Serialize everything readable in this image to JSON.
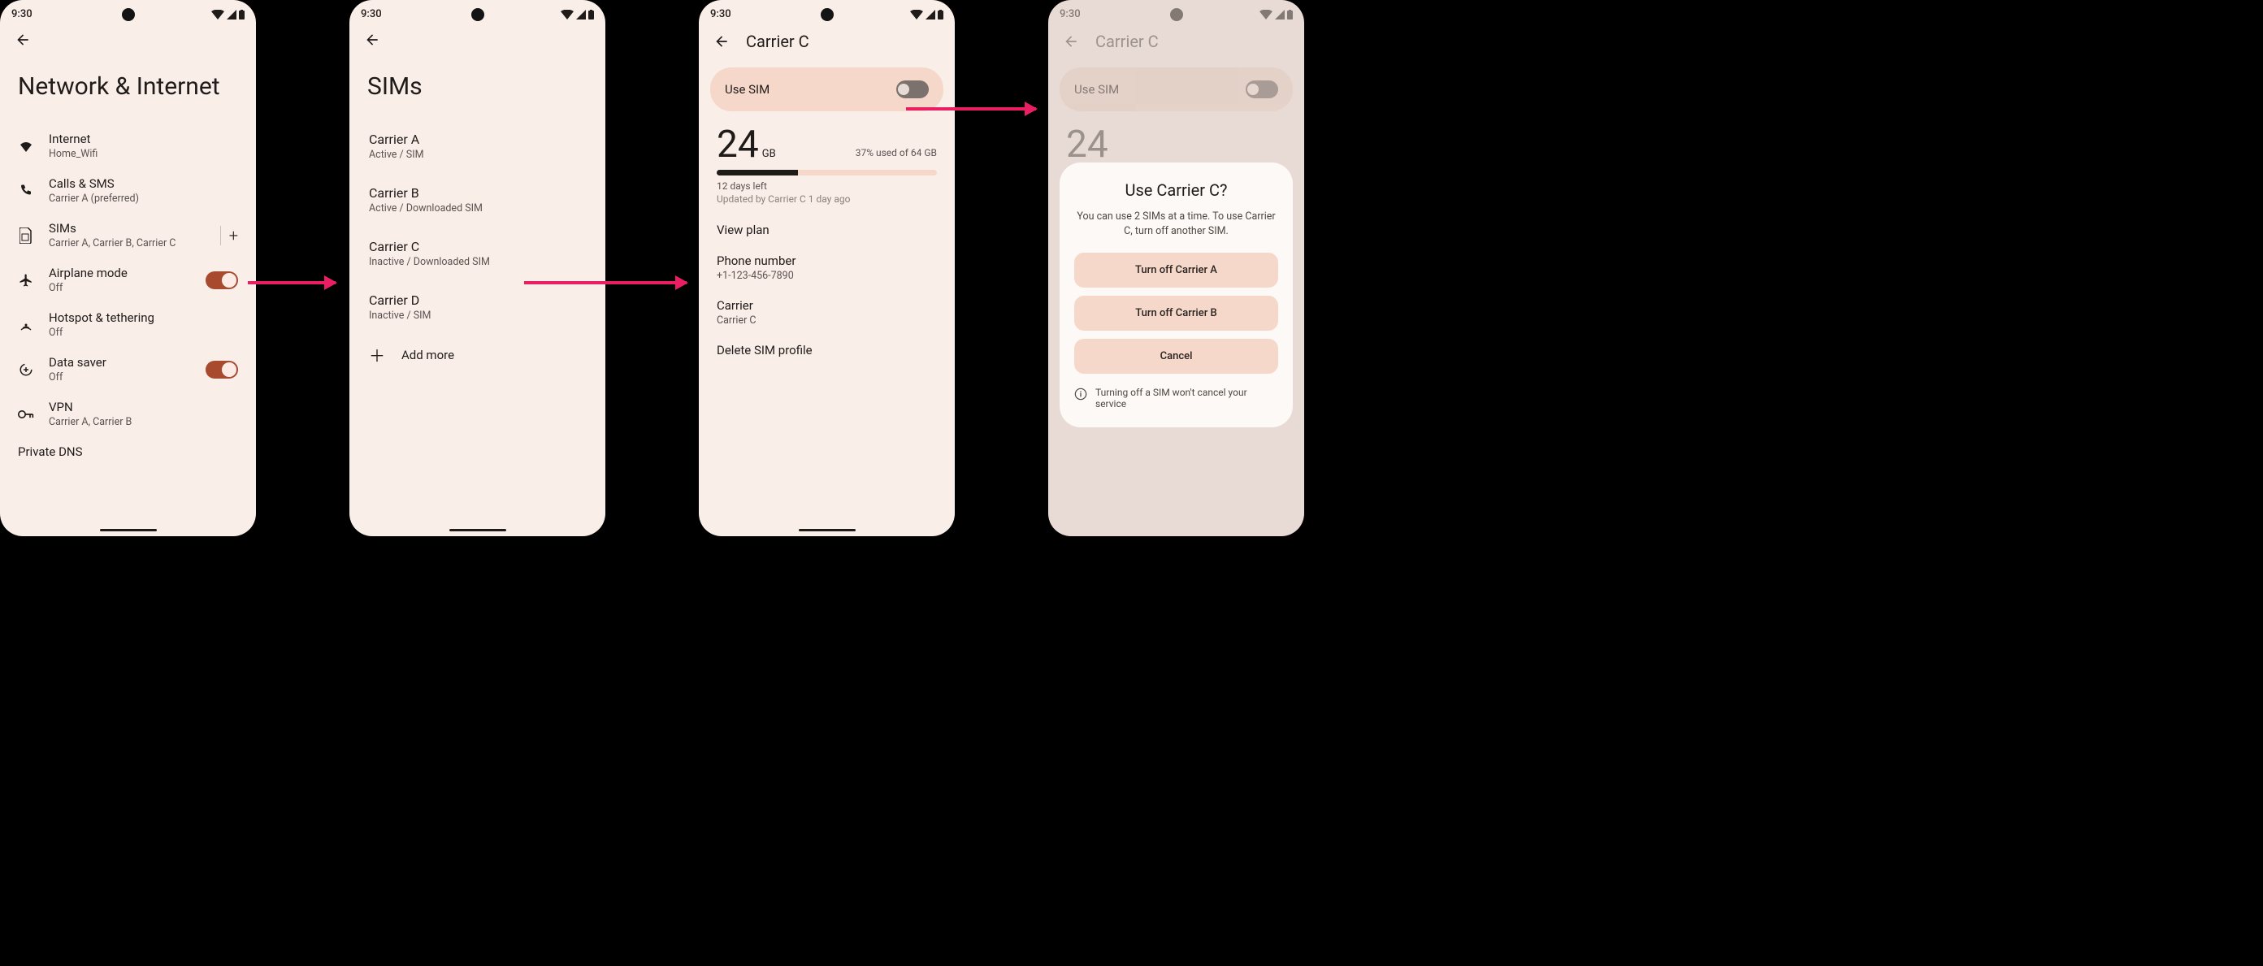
{
  "status": {
    "time": "9:30"
  },
  "screen1": {
    "title": "Network & Internet",
    "items": {
      "internet": {
        "label": "Internet",
        "sub": "Home_Wifi"
      },
      "calls": {
        "label": "Calls & SMS",
        "sub": "Carrier A (preferred)"
      },
      "sims": {
        "label": "SIMs",
        "sub": "Carrier A, Carrier B, Carrier C"
      },
      "airplane": {
        "label": "Airplane mode",
        "sub": "Off"
      },
      "hotspot": {
        "label": "Hotspot & tethering",
        "sub": "Off"
      },
      "datasaver": {
        "label": "Data saver",
        "sub": "Off"
      },
      "vpn": {
        "label": "VPN",
        "sub": "Carrier A, Carrier B"
      },
      "dns": {
        "label": "Private DNS"
      }
    }
  },
  "screen2": {
    "title": "SIMs",
    "carrierA": {
      "label": "Carrier A",
      "sub": "Active / SIM"
    },
    "carrierB": {
      "label": "Carrier B",
      "sub": "Active / Downloaded SIM"
    },
    "carrierC": {
      "label": "Carrier C",
      "sub": "Inactive / Downloaded SIM"
    },
    "carrierD": {
      "label": "Carrier D",
      "sub": "Inactive / SIM"
    },
    "addmore": "Add more"
  },
  "screen3": {
    "title": "Carrier C",
    "usesim": "Use SIM",
    "data_amount": "24",
    "data_unit": "GB",
    "data_used": "37% used of 64 GB",
    "days_left": "12 days left",
    "updated": "Updated by Carrier C 1 day ago",
    "viewplan": "View plan",
    "phone_label": "Phone number",
    "phone_value": "+1-123-456-7890",
    "carrier_label": "Carrier",
    "carrier_value": "Carrier C",
    "delete": "Delete SIM profile"
  },
  "screen4": {
    "title": "Carrier C",
    "usesim": "Use SIM",
    "data_amount": "24",
    "dialog": {
      "title": "Use Carrier C?",
      "body": "You can use 2 SIMs at a time. To use Carrier C, turn off another SIM.",
      "btn1": "Turn off Carrier A",
      "btn2": "Turn off Carrier B",
      "btn3": "Cancel",
      "info": "Turning off a SIM won't cancel your service"
    }
  }
}
